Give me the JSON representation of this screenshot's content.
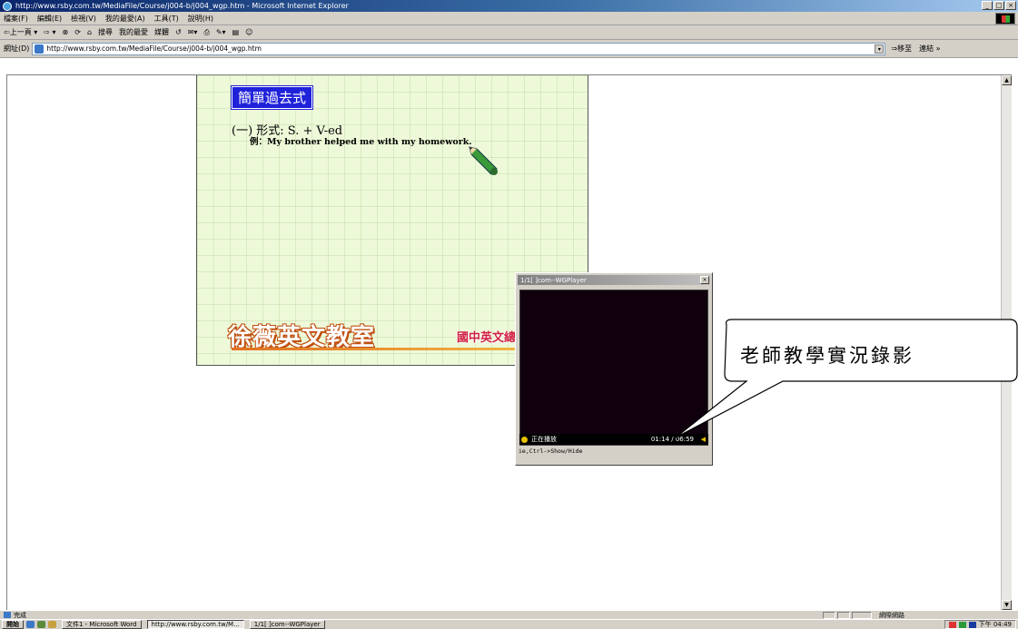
{
  "window": {
    "title": "http://www.rsby.com.tw/MediaFile/Course/j004-b/j004_wgp.htm - Microsoft Internet Explorer",
    "min": "_",
    "max": "□",
    "close": "×"
  },
  "menu": [
    "檔案(F)",
    "編輯(E)",
    "檢視(V)",
    "我的最愛(A)",
    "工具(T)",
    "說明(H)"
  ],
  "toolbar": [
    "⇦上一頁 ▾",
    "⇨ ▾",
    "⊗",
    "⟳",
    "⌂",
    "搜尋",
    "我的最愛",
    "媒體",
    "↺",
    "✉▾",
    "⎙",
    "✎▾",
    "▤",
    "☺"
  ],
  "address": {
    "label": "網址(D)",
    "url": "http://www.rsby.com.tw/MediaFile/Course/j004-b/j004_wgp.htm",
    "dropdown": "▾",
    "go": "⇒移至",
    "links": "連結 »"
  },
  "slide": {
    "title": "簡單過去式",
    "line1": "(一) 形式: S. + V-ed",
    "line2": "例：My brother helped me with my homework.",
    "brand": "徐薇英文教室",
    "course": "國中英文總複習"
  },
  "player": {
    "title": "1/1[ ]com--WGPlayer",
    "close": "×",
    "status": "正在播放",
    "time": "01:14 / 06:59",
    "volume": "◀",
    "hint": "ie,Ctrl->Show/Hide"
  },
  "callout": {
    "text": "老師教學實況錄影"
  },
  "scrollbar": {
    "up": "▲",
    "down": "▼"
  },
  "statusbar": {
    "text": "完成",
    "zone": "網際網路"
  },
  "taskbar": {
    "start": "開始",
    "tasks": [
      "文件1 - Microsoft Word",
      "http://www.rsby.com.tw/M...",
      "1/1[ ]com--WGPlayer"
    ],
    "clock": "下午 04:49"
  },
  "colors": {
    "slide_bg": "#eef9d9",
    "title_blue": "#1f22d9",
    "brand_orange": "#e07020",
    "course_red": "#d02040",
    "player_video": "#10000e"
  }
}
